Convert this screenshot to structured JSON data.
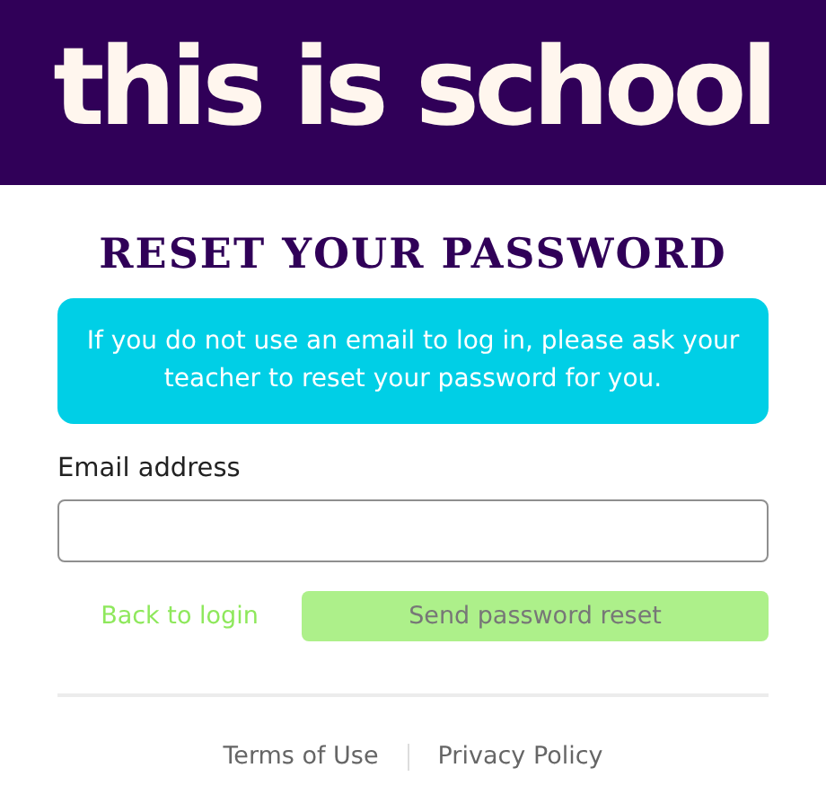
{
  "logo": {
    "text": "this is school"
  },
  "title": "RESET YOUR PASSWORD",
  "notice": "If you do not use an email to log in, please ask your teacher to reset your password for you.",
  "email_field": {
    "label": "Email address"
  },
  "back_link": "Back to login",
  "send_button": {
    "label": "Send password reset",
    "disabled": true
  },
  "footer_links": [
    "Terms of Use",
    "Privacy Policy"
  ]
}
